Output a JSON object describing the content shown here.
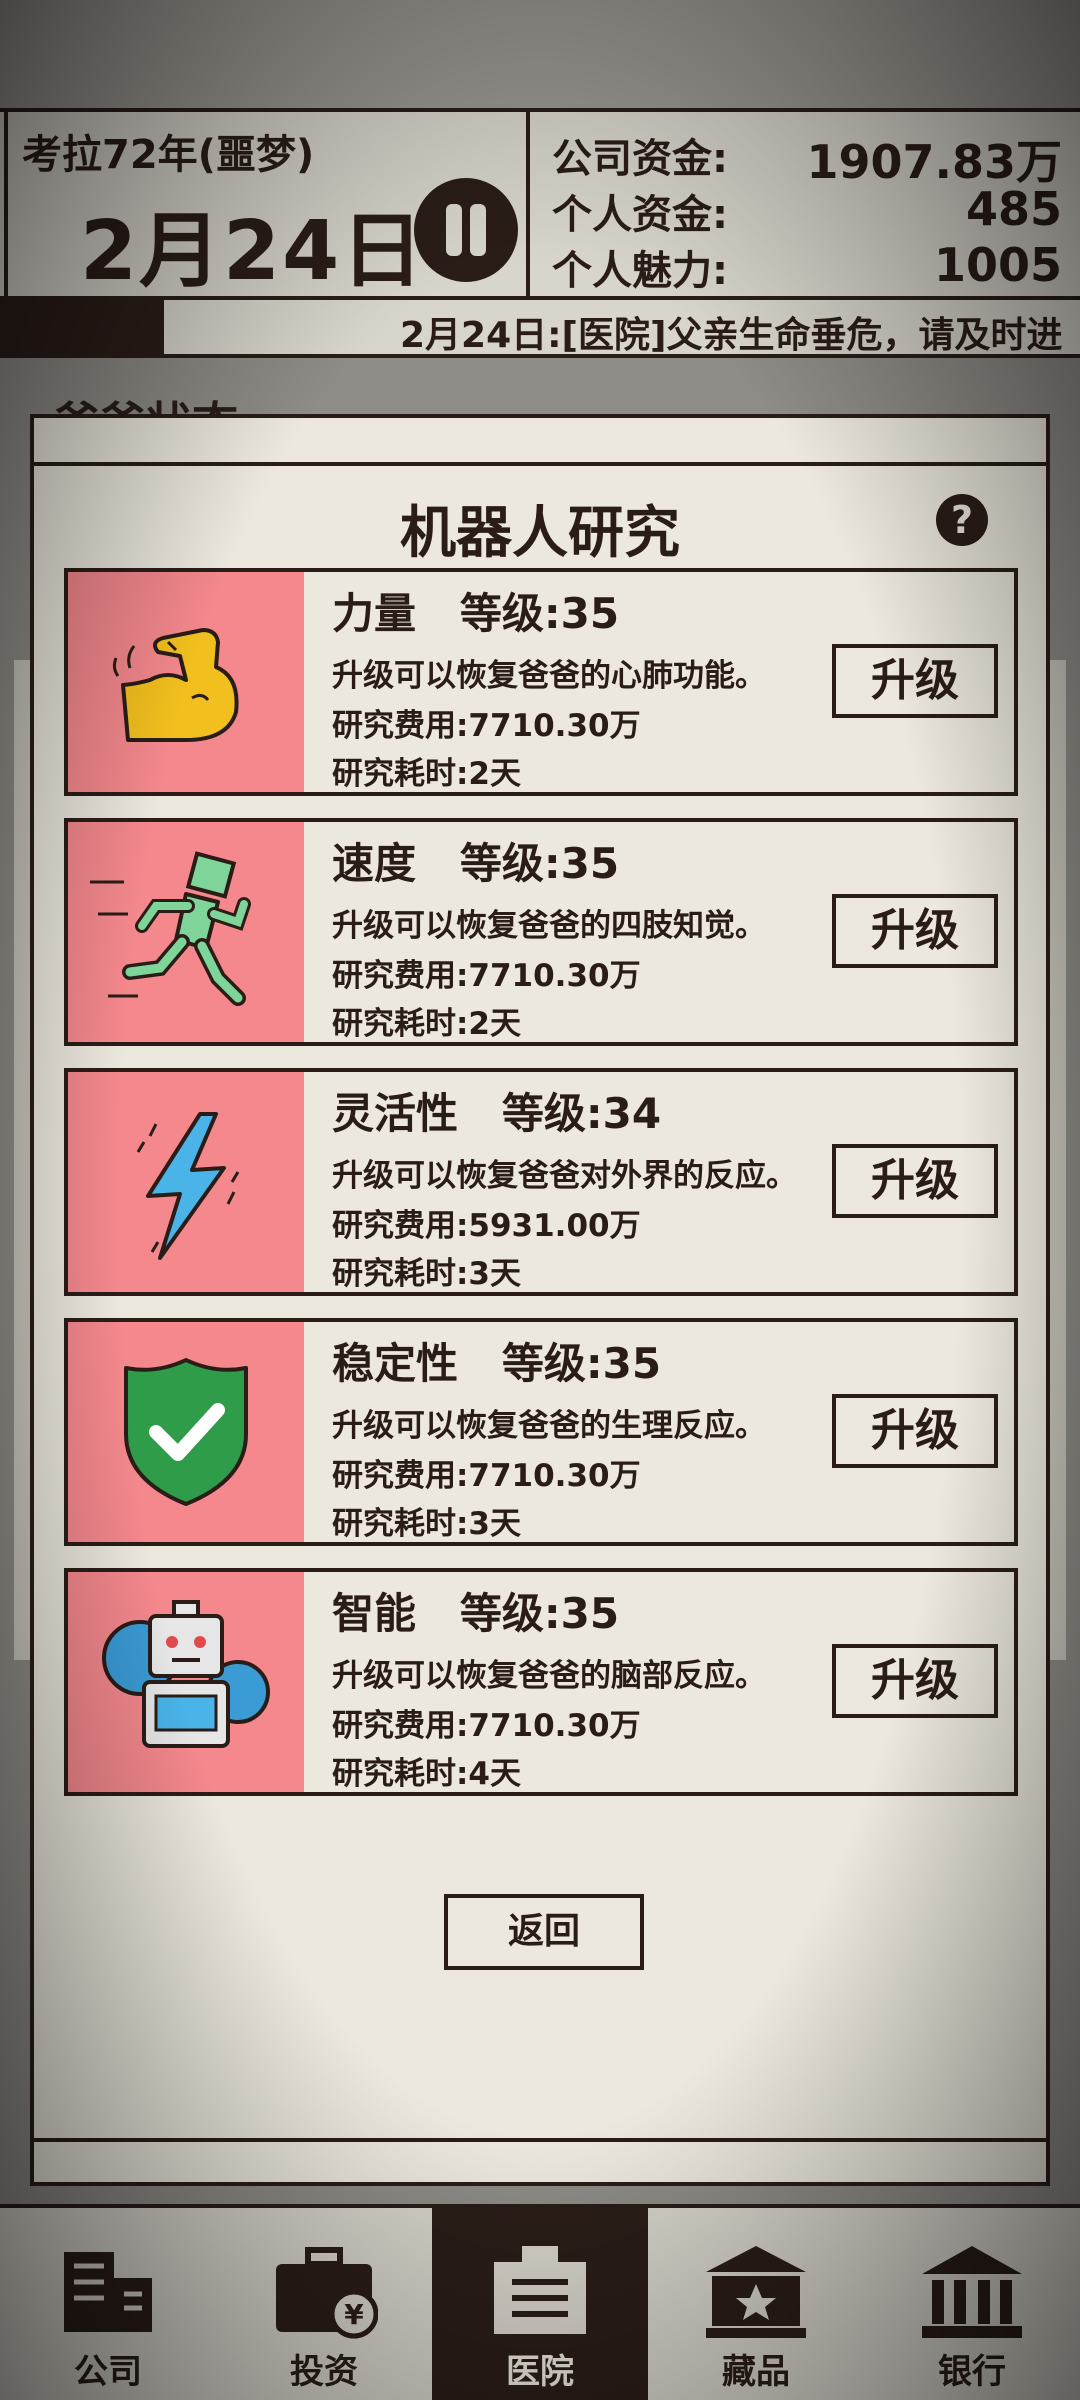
{
  "header": {
    "era": "考拉72年(噩梦)",
    "date": "2月24日",
    "stats": [
      {
        "label": "公司资金:",
        "value": "1907.83万"
      },
      {
        "label": "个人资金:",
        "value": "485"
      },
      {
        "label": "个人魅力:",
        "value": "1005"
      }
    ],
    "ticker": "2月24日:[医院]父亲生命垂危，请及时进"
  },
  "background": {
    "section_title": "爸爸状态"
  },
  "modal": {
    "title": "机器人研究",
    "help_icon": "?",
    "back_label": "返回",
    "cards": [
      {
        "name": "力量   等级:35",
        "desc": "升级可以恢复爸爸的心肺功能。",
        "cost": "研究费用:7710.30万",
        "time": "研究耗时:2天",
        "button": "升级",
        "icon": "flexed-arm-icon"
      },
      {
        "name": "速度   等级:35",
        "desc": "升级可以恢复爸爸的四肢知觉。",
        "cost": "研究费用:7710.30万",
        "time": "研究耗时:2天",
        "button": "升级",
        "icon": "running-robot-icon"
      },
      {
        "name": "灵活性   等级:34",
        "desc": "升级可以恢复爸爸对外界的反应。",
        "cost": "研究费用:5931.00万",
        "time": "研究耗时:3天",
        "button": "升级",
        "icon": "lightning-icon"
      },
      {
        "name": "稳定性   等级:35",
        "desc": "升级可以恢复爸爸的生理反应。",
        "cost": "研究费用:7710.30万",
        "time": "研究耗时:3天",
        "button": "升级",
        "icon": "shield-check-icon"
      },
      {
        "name": "智能   等级:35",
        "desc": "升级可以恢复爸爸的脑部反应。",
        "cost": "研究费用:7710.30万",
        "time": "研究耗时:4天",
        "button": "升级",
        "icon": "robot-gear-icon"
      }
    ]
  },
  "nav": [
    {
      "label": "公司",
      "icon": "building-icon",
      "active": false
    },
    {
      "label": "投资",
      "icon": "briefcase-yen-icon",
      "active": false
    },
    {
      "label": "医院",
      "icon": "hospital-icon",
      "active": true
    },
    {
      "label": "藏品",
      "icon": "museum-star-icon",
      "active": false
    },
    {
      "label": "银行",
      "icon": "bank-icon",
      "active": false
    }
  ],
  "colors": {
    "ink": "#2a1d18",
    "paper": "#ece8de",
    "card_image_bg": "#f4888d"
  }
}
